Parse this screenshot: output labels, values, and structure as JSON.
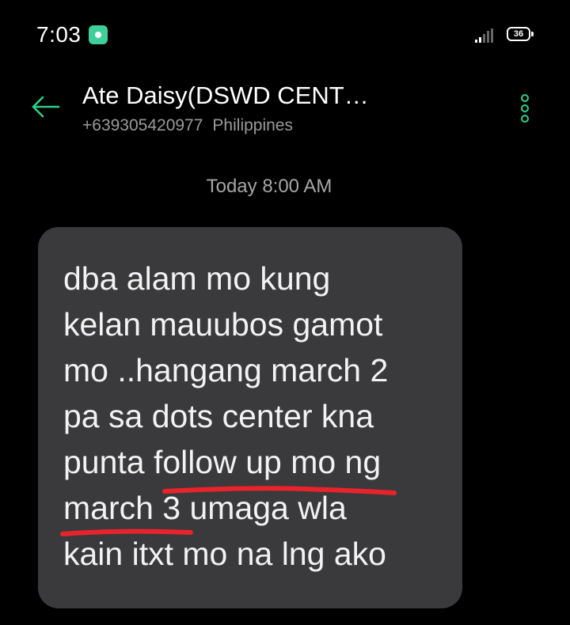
{
  "status_bar": {
    "time": "7:03",
    "app_icon": "messenger-notification-icon",
    "signal_icon": "signal-strength-icon",
    "battery_level": "36"
  },
  "header": {
    "back_icon": "back-arrow-icon",
    "contact_name": "Ate Daisy(DSWD CENT…",
    "phone_number": "+639305420977",
    "country": "Philippines",
    "more_icon": "more-vertical-icon"
  },
  "conversation": {
    "timestamp": "Today 8:00 AM",
    "message": {
      "lines": [
        "dba alam mo kung",
        "kelan mauubos gamot",
        "mo ..hangang march 2",
        "pa sa dots center kna",
        "punta follow up mo ng",
        "march 3 umaga wla",
        "kain itxt mo na lng ako"
      ],
      "annotations": [
        {
          "type": "red-underline",
          "text": "follow up mo ng"
        },
        {
          "type": "red-underline",
          "text": "march 3"
        }
      ]
    }
  },
  "colors": {
    "background": "#000000",
    "bubble": "#3a3a3c",
    "accent": "#2fd08a",
    "annotation": "#e8232b",
    "muted_text": "#9a9a9a"
  }
}
